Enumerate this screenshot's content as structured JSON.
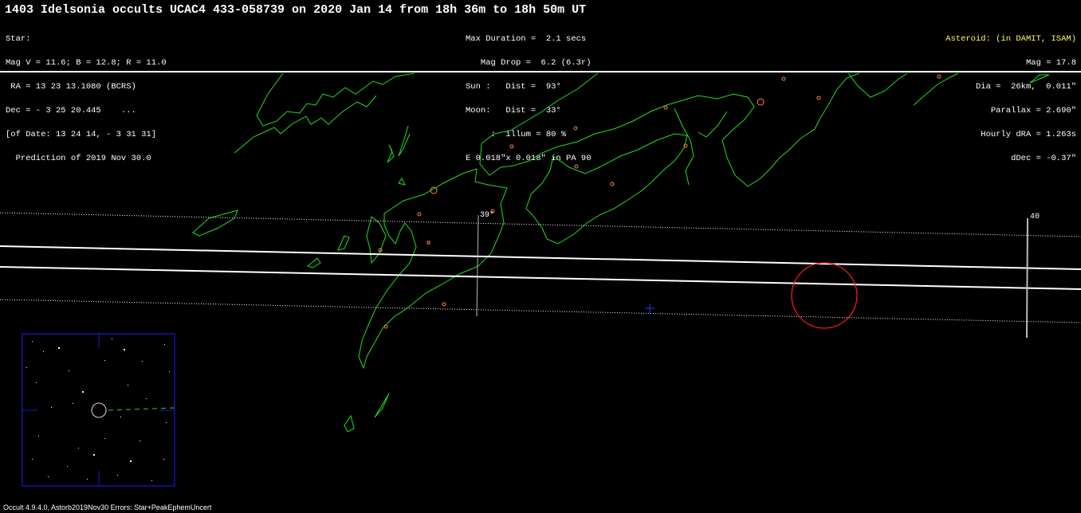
{
  "title": "1403 Idelsonia occults UCAC4 433-058739 on 2020 Jan 14 from 18h 36m to 18h 50m UT",
  "star_block": [
    "Star:",
    "Mag V = 11.6; B = 12.8; R = 11.0",
    " RA = 13 23 13.1080 (BCRS)",
    "Dec = - 3 25 20.445    ...",
    "[of Date: 13 24 14, - 3 31 31]",
    "  Prediction of 2019 Nov 30.0"
  ],
  "event_block": [
    "Max Duration =  2.1 secs",
    "   Mag Drop =  6.2 (6.3r)",
    "Sun :   Dist =  93°",
    "Moon:   Dist =  33°",
    "     :  illum = 80 %",
    "E 0.018\"x 0.018\" in PA 90"
  ],
  "asteroid_block": {
    "heading": "Asteroid: (in DAMIT, ISAM)",
    "lines": [
      "Mag = 17.8",
      "Dia =  26km,  0.011\"",
      "Parallax = 2.690\"",
      "Hourly dRA = 1.263s",
      "dDec = -0.37\""
    ]
  },
  "map": {
    "longitude_labels": [
      "39°",
      "40"
    ],
    "colors": {
      "coastline": "#22dd22",
      "path": "#ffffff",
      "asteroid_circle": "#ff2020",
      "city": "#ff8844",
      "inset_frame": "#1a1acc",
      "center_cross": "#3333ff"
    }
  },
  "footer": "Occult 4.9.4.0, Astorb2019Nov30 Errors: Star+PeakEphemUncert"
}
